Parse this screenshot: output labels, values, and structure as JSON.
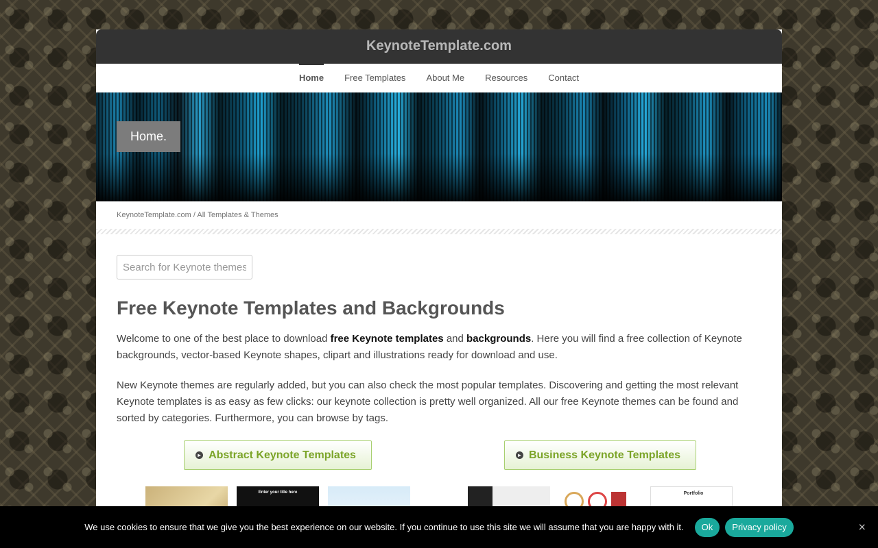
{
  "site": {
    "title": "KeynoteTemplate.com"
  },
  "nav": {
    "items": [
      {
        "label": "Home",
        "active": true
      },
      {
        "label": "Free Templates",
        "active": false
      },
      {
        "label": "About Me",
        "active": false
      },
      {
        "label": "Resources",
        "active": false
      },
      {
        "label": "Contact",
        "active": false
      }
    ]
  },
  "hero": {
    "title": "Home."
  },
  "breadcrumb": {
    "root": "KeynoteTemplate.com",
    "separator": " / ",
    "current": "All Templates & Themes"
  },
  "search": {
    "placeholder": "Search for Keynote themes"
  },
  "main": {
    "heading": "Free Keynote Templates and Backgrounds",
    "intro": {
      "part1": "Welcome to one of the best place to download ",
      "bold1": "free Keynote templates",
      "part2": " and ",
      "bold2": "backgrounds",
      "part3": ". Here you will find a free collection of Keynote backgrounds, vector-based Keynote shapes, clipart and illustrations ready for download and use."
    },
    "paragraph2": "New Keynote themes are regularly added, but you can also check the most popular templates. Discovering and getting the most relevant Keynote templates is as easy as few clicks: our keynote collection is pretty well organized. All our free Keynote themes can be found and sorted by categories. Furthermore, you can browse by tags."
  },
  "categories": [
    {
      "label": "Abstract Keynote Templates",
      "icon": "arrow-circle-icon",
      "thumbs": [
        {
          "text": ""
        },
        {
          "text": "Enter your title here"
        },
        {
          "text": ""
        }
      ]
    },
    {
      "label": "Business Keynote Templates",
      "icon": "arrow-circle-icon",
      "thumbs": [
        {
          "text": ""
        },
        {
          "text": ""
        },
        {
          "text": "Portfolio"
        }
      ]
    }
  ],
  "cookie": {
    "text": "We use cookies to ensure that we give you the best experience on our website. If you continue to use this site we will assume that you are happy with it.",
    "ok_label": "Ok",
    "privacy_label": "Privacy policy",
    "close_glyph": "×"
  },
  "colors": {
    "accent_green": "#7ba428",
    "cookie_button": "#1aa99c",
    "topbar": "#333333"
  }
}
